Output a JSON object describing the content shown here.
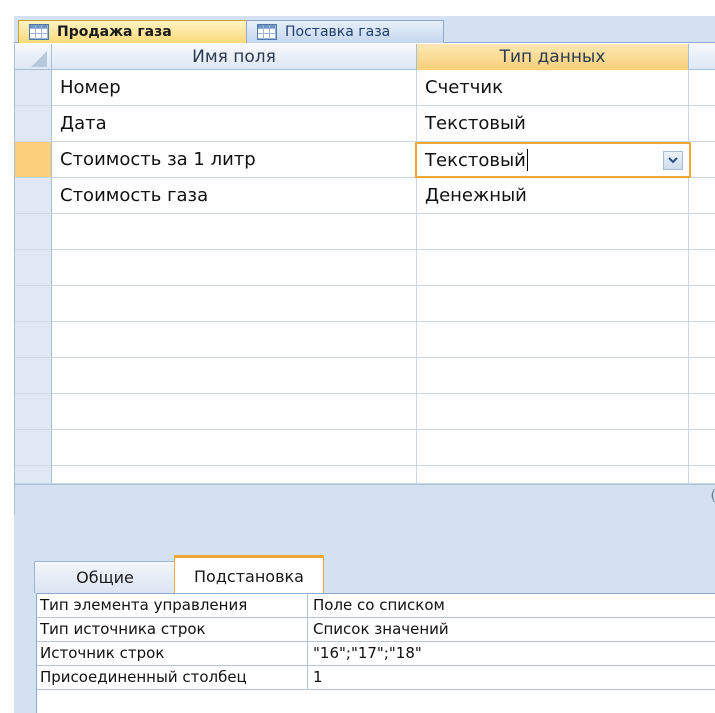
{
  "tabs": [
    {
      "label": "Продажа газа",
      "icon": "table-icon",
      "active": true
    },
    {
      "label": "Поставка газа",
      "icon": "table-icon",
      "active": false
    }
  ],
  "grid": {
    "columns": {
      "field_name": "Имя поля",
      "data_type": "Тип данных"
    },
    "rows": [
      {
        "name": "Номер",
        "type": "Счетчик"
      },
      {
        "name": "Дата",
        "type": "Текстовый"
      },
      {
        "name": "Стоимость за 1 литр",
        "type": "Текстовый",
        "current": true
      },
      {
        "name": "Стоимость газа",
        "type": "Денежный"
      }
    ],
    "empty_rows": 8
  },
  "properties": {
    "tabs": {
      "general": "Общие",
      "lookup": "Подстановка"
    },
    "rows": [
      {
        "name": "Тип элемента управления",
        "value": "Поле со списком"
      },
      {
        "name": "Тип источника строк",
        "value": "Список значений"
      },
      {
        "name": "Источник строк",
        "value": "\"16\";\"17\";\"18\""
      },
      {
        "name": "Присоединенный столбец",
        "value": "1"
      }
    ]
  },
  "colors": {
    "active_tab": "#fcd97a",
    "accent_orange": "#f2a634",
    "panel_blue": "#d4e1f2"
  }
}
